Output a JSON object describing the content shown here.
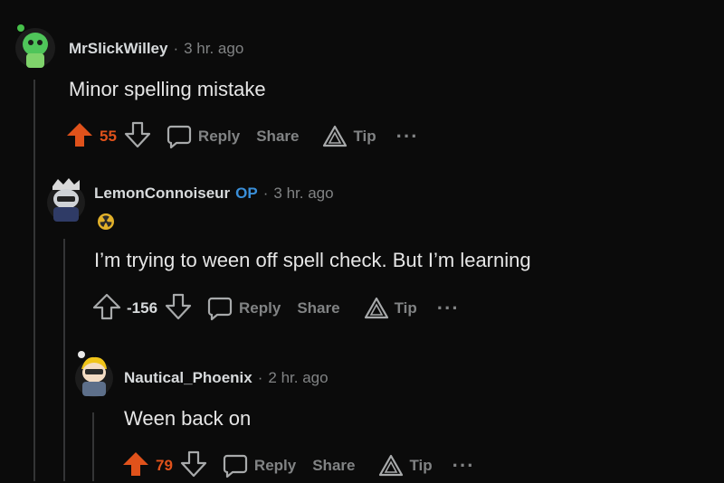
{
  "colors": {
    "background": "#0b0b0b",
    "upvote_active": "#e0521b",
    "op_badge": "#3a8fd9",
    "muted": "#818384"
  },
  "comments": [
    {
      "username": "MrSlickWilley",
      "separator": "·",
      "time": "3 hr. ago",
      "body": "Minor spelling mistake",
      "score": "55",
      "vote_state": "upvoted",
      "actions": {
        "reply": "Reply",
        "share": "Share",
        "tip": "Tip",
        "more": "···"
      }
    },
    {
      "username": "LemonConnoiseur",
      "op_label": "OP",
      "separator": "·",
      "time": "3 hr. ago",
      "flair_icon": "radioactive-icon",
      "body": "I’m trying to ween off spell check. But I’m learning",
      "score": "-156",
      "vote_state": "none",
      "actions": {
        "reply": "Reply",
        "share": "Share",
        "tip": "Tip",
        "more": "···"
      }
    },
    {
      "username": "Nautical_Phoenix",
      "separator": "·",
      "time": "2 hr. ago",
      "body": "Ween back on",
      "score": "79",
      "vote_state": "upvoted",
      "actions": {
        "reply": "Reply",
        "share": "Share",
        "tip": "Tip",
        "more": "···"
      }
    }
  ]
}
